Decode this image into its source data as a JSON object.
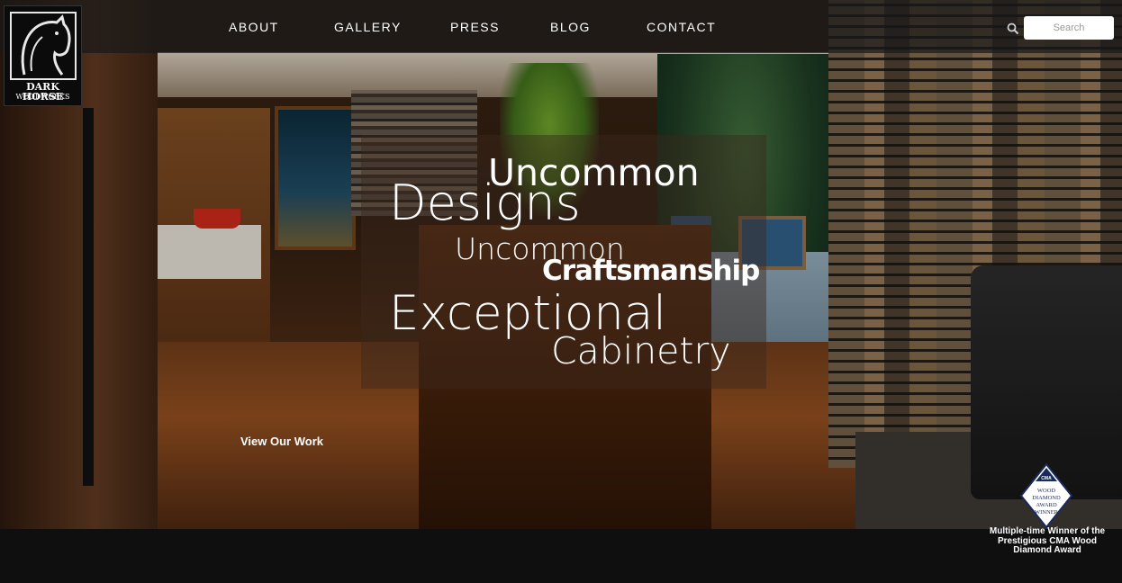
{
  "brand": {
    "name": "DARK HORSE",
    "subname": "WOODWORKS"
  },
  "nav": {
    "items": [
      {
        "label": "ABOUT"
      },
      {
        "label": "GALLERY"
      },
      {
        "label": "PRESS"
      },
      {
        "label": "BLOG"
      },
      {
        "label": "CONTACT"
      }
    ]
  },
  "search": {
    "placeholder": "Search",
    "icon": "search-icon"
  },
  "hero": {
    "lines": [
      "Uncommon",
      "Designs",
      "Uncommon",
      "Craftsmanship",
      "Exceptional",
      "Cabinetry"
    ],
    "cta": "View Our Work"
  },
  "award": {
    "badge_lines": [
      "CMA",
      "WOOD",
      "DIAMOND",
      "AWARD",
      "WINNER"
    ],
    "caption": "Multiple-time Winner of the Prestigious CMA Wood Diamond Award"
  },
  "colors": {
    "nav_bg": "#191919",
    "footer_bg": "#0f0f0f",
    "text": "#ffffff"
  }
}
